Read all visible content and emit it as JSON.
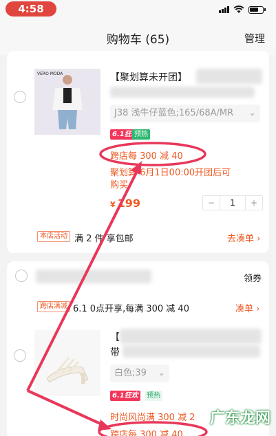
{
  "status": {
    "time": "4:58"
  },
  "nav": {
    "title": "购物车 (65)",
    "manage": "管理"
  },
  "item1": {
    "brand_logo": "VERO MODA",
    "title": "【聚划算未开团】",
    "sku": "J38 浅牛仔蓝色;165/68A/MR",
    "tag_promo": "6.1狂欢",
    "tag_presale": "预热",
    "cross_store": "跨店每 300 减 40",
    "juhuasuan_line1": "聚划算 6月1日00:00开团后可",
    "juhuasuan_line2": "购买",
    "currency": "¥",
    "price": "199",
    "qty": "1",
    "minus": "−",
    "plus": "+"
  },
  "shop1_footer": {
    "tag": "本店活动",
    "text": "满 2 件 享包邮",
    "link": "去凑单 ›"
  },
  "shop2": {
    "coupon": "领券",
    "tag": "跨店满减",
    "promo_text": "6.1 0点开享,每满 300 减 40",
    "link": "凑单 ›"
  },
  "item2": {
    "title_prefix": "【",
    "title_line2": "带",
    "sku": "白色;39",
    "tag_promo": "6.1狂欢",
    "tag_presale": "预热",
    "promo_partial": "时尚风尚满 300 减 2",
    "cross_store": "跨店每 300 减 40"
  },
  "watermark": "广东龙网",
  "annotation": {
    "color": "#e8375a"
  }
}
